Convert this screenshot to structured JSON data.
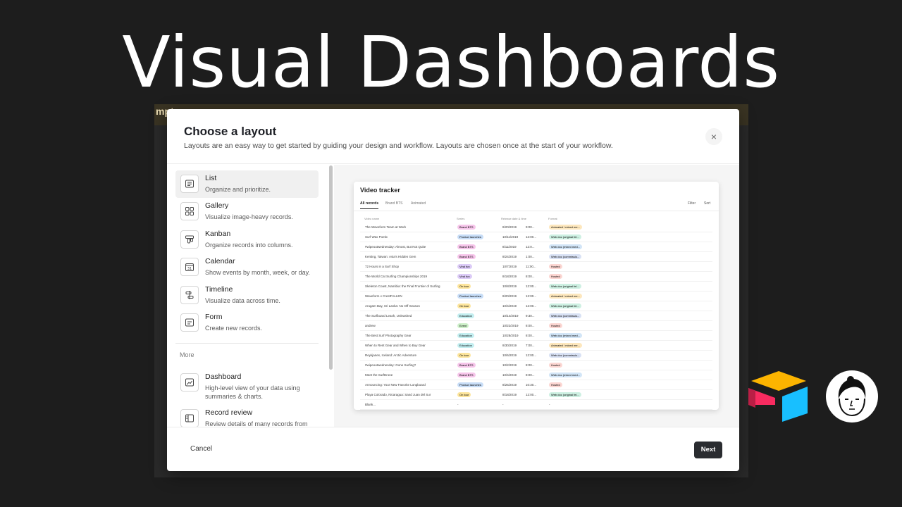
{
  "headline": "Visual Dashboards",
  "backdrop": {
    "fragment": "mpt"
  },
  "modal": {
    "title": "Choose a layout",
    "subtitle": "Layouts are an easy way to get started by guiding your design and workflow. Layouts are chosen once at the start of your workflow.",
    "close_icon": "×",
    "cancel_label": "Cancel",
    "next_label": "Next"
  },
  "layouts": [
    {
      "title": "List",
      "desc": "Organize and prioritize.",
      "icon": "list-icon",
      "selected": true
    },
    {
      "title": "Gallery",
      "desc": "Visualize image-heavy records.",
      "icon": "gallery-icon"
    },
    {
      "title": "Kanban",
      "desc": "Organize records into columns.",
      "icon": "kanban-icon"
    },
    {
      "title": "Calendar",
      "desc": "Show events by month, week, or day.",
      "icon": "calendar-icon"
    },
    {
      "title": "Timeline",
      "desc": "Visualize data across time.",
      "icon": "timeline-icon"
    },
    {
      "title": "Form",
      "desc": "Create new records.",
      "icon": "form-icon"
    }
  ],
  "more_label": "More",
  "more_layouts": [
    {
      "title": "Dashboard",
      "desc": "High-level view of your data using summaries & charts.",
      "icon": "dashboard-icon"
    },
    {
      "title": "Record review",
      "desc": "Review details of many records from",
      "icon": "record-review-icon"
    }
  ],
  "preview": {
    "title": "Video tracker",
    "tabs": [
      "All records",
      "Brand BTS",
      "Animated"
    ],
    "tools": [
      "Filter",
      "Sort"
    ],
    "columns": [
      "Video name",
      "Series",
      "Release date & time",
      "Format"
    ],
    "rows": [
      [
        "The Waveform Team at Work",
        "Brand BTS",
        "8/20/2019",
        "9:00...",
        "Animated / mixed me..."
      ],
      [
        "Surf Wax Poetic",
        "Product launches",
        "10/11/2019",
        "12:00...",
        "Web doc (original fel..."
      ],
      [
        "#wipeoutwednesday: Almost, But Not Quite",
        "Brand BTS",
        "8/11/2019",
        "12:0...",
        "Web doc (mixed med..."
      ],
      [
        "Kenting, Taiwan: Asia's Hidden Gem",
        "Brand BTS",
        "8/24/2019",
        "1:00...",
        "Web doc (commissio..."
      ],
      [
        "72 Hours in a Surf Shop",
        "Viral fun",
        "10/7/2019",
        "11:00...",
        "Hosted"
      ],
      [
        "The World Cat Surfing Championships 2019",
        "Viral fun",
        "8/18/2019",
        "8:00...",
        "Hosted"
      ],
      [
        "Skeleton Coast, Namibia: the Final Frontier of Surfing",
        "On tour",
        "10/8/2019",
        "12:00...",
        "Web doc (original fel..."
      ],
      [
        "Waveform x CrestFALLEN",
        "Product launches",
        "8/20/2019",
        "12:00...",
        "Animated / mixed me..."
      ],
      [
        "Arugam Bay, Sri Lanka: No Off Season",
        "On tour",
        "10/4/2019",
        "12:00...",
        "Web doc (original fel..."
      ],
      [
        "The Surfboard Leash, Unleashed",
        "Education",
        "10/14/2019",
        "9:30...",
        "Web doc (commissio..."
      ],
      [
        "andrew",
        "Event",
        "10/22/2019",
        "8:00...",
        "Hosted"
      ],
      [
        "The Best Surf Photography Gear",
        "Education",
        "10/28/2019",
        "8:00...",
        "Web doc (mixed med..."
      ],
      [
        "When to Rent Gear and When to Buy Gear",
        "Education",
        "8/30/2019",
        "7:00...",
        "Animated / mixed me..."
      ],
      [
        "Reykjanes, Iceland: Arctic Adventure",
        "On tour",
        "10/6/2019",
        "12:00...",
        "Web doc (commissio..."
      ],
      [
        "#wipeoutwednesday: Gone Surfing?",
        "Brand BTS",
        "10/2/2019",
        "8:00...",
        "Hosted"
      ],
      [
        "Meet the SurfDrone",
        "Brand BTS",
        "10/4/2019",
        "8:00...",
        "Web doc (mixed med..."
      ],
      [
        "Announcing: Your New Favorite Longboard",
        "Product launches",
        "8/25/2019",
        "10:30...",
        "Hosted"
      ],
      [
        "Playa Colorado, Nicaragua: Sand Juan del Sur",
        "On tour",
        "8/18/2019",
        "12:00...",
        "Web doc (original fel..."
      ],
      [
        "Blank...",
        "-",
        "-",
        "",
        "-"
      ]
    ]
  },
  "series_colors": {
    "Brand BTS": "#f6c5ea",
    "Product launches": "#c7ddf7",
    "Viral fun": "#dccbf7",
    "On tour": "#fde59c",
    "Education": "#c3eef0",
    "Event": "#cdf0c9"
  },
  "format_colors": {
    "Animated": "#fde7bd",
    "Web doc (original": "#cdf0e2",
    "Web doc (mixed": "#d2e5f7",
    "Web doc (commissio": "#d8e1f4",
    "Hosted": "#fcd6d2"
  },
  "brand": {
    "logo_icon": "airtable-logo-icon",
    "avatar_icon": "avatar-icon"
  }
}
